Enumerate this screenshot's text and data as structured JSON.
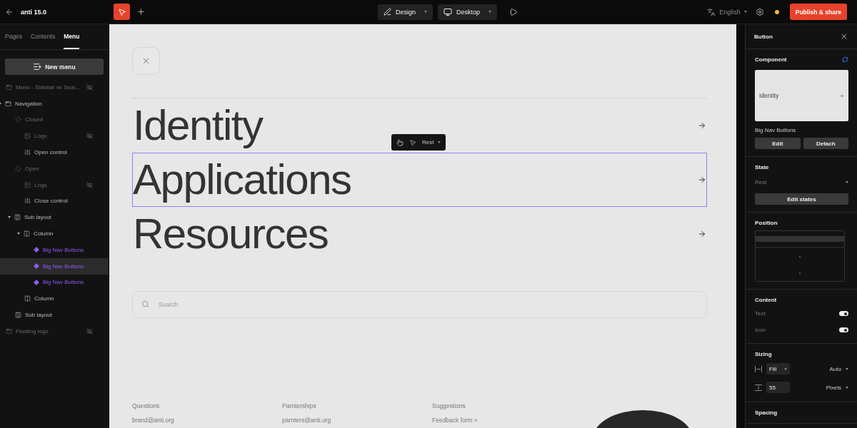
{
  "app": {
    "title": "anti 15.0"
  },
  "toolbar": {
    "mode": "Design",
    "device": "Desktop",
    "language": "English",
    "publish": "Publish & share"
  },
  "sidebar": {
    "tabs": [
      {
        "label": "Pages",
        "selected": false
      },
      {
        "label": "Contents",
        "selected": false
      },
      {
        "label": "Menu",
        "selected": true
      }
    ],
    "new_menu": "New menu",
    "tree": [
      {
        "label": "Menu - Sidebar w/ Sear...",
        "kind": "frame",
        "dimmed": true,
        "hidden": true,
        "selected": false
      },
      {
        "label": "Navigation",
        "kind": "frame",
        "dimmed": false,
        "hidden": false,
        "selected": false,
        "expanded": true,
        "children": [
          {
            "label": "Closed",
            "kind": "state",
            "dimmed": true,
            "hidden": false,
            "selected": false,
            "children": [
              {
                "label": "Logo",
                "kind": "image",
                "dimmed": true,
                "hidden": true,
                "selected": false
              },
              {
                "label": "Open control",
                "kind": "control",
                "dimmed": false,
                "hidden": false,
                "selected": false
              }
            ]
          },
          {
            "label": "Open",
            "kind": "state",
            "dimmed": true,
            "hidden": false,
            "selected": false,
            "children": [
              {
                "label": "Logo",
                "kind": "image",
                "dimmed": true,
                "hidden": true,
                "selected": false
              },
              {
                "label": "Close control",
                "kind": "control",
                "dimmed": false,
                "hidden": false,
                "selected": false
              }
            ]
          },
          {
            "label": "Sub layout",
            "kind": "layout",
            "dimmed": false,
            "hidden": false,
            "selected": false,
            "expanded": true,
            "children": [
              {
                "label": "Column",
                "kind": "column",
                "dimmed": false,
                "hidden": false,
                "selected": false,
                "expanded": true,
                "children": [
                  {
                    "label": "Big Nav Buttons",
                    "kind": "component",
                    "dimmed": false,
                    "hidden": false,
                    "selected": false
                  },
                  {
                    "label": "Big Nav Buttons",
                    "kind": "component",
                    "dimmed": false,
                    "hidden": false,
                    "selected": true
                  },
                  {
                    "label": "Big Nav Buttons",
                    "kind": "component",
                    "dimmed": false,
                    "hidden": false,
                    "selected": false
                  }
                ]
              },
              {
                "label": "Column",
                "kind": "column",
                "dimmed": false,
                "hidden": false,
                "selected": false
              }
            ]
          },
          {
            "label": "Sub layout",
            "kind": "layout",
            "dimmed": false,
            "hidden": false,
            "selected": false
          }
        ]
      },
      {
        "label": "Floating logo",
        "kind": "frame",
        "dimmed": true,
        "hidden": true,
        "selected": false
      }
    ]
  },
  "canvas": {
    "nav_items": [
      {
        "label": "Identity",
        "selected": false
      },
      {
        "label": "Applications",
        "selected": true
      },
      {
        "label": "Resources",
        "selected": false
      }
    ],
    "hover_toolbar": {
      "state": "Rest"
    },
    "search": {
      "placeholder": "Search"
    },
    "footer": [
      {
        "heading": "Questions",
        "link": "brand@anti.org"
      },
      {
        "heading": "Parnterships",
        "link": "parnters@anti.org"
      },
      {
        "heading": "Suggestions",
        "link": "Feedback form »"
      }
    ]
  },
  "inspector": {
    "title": "Button",
    "component": {
      "heading": "Component",
      "preview": "Identity",
      "name": "Big Nav Buttons",
      "buttons": [
        "Edit",
        "Detach"
      ]
    },
    "state": {
      "heading": "State",
      "value": "Rest",
      "button": "Edit states"
    },
    "position": {
      "heading": "Position"
    },
    "content": {
      "heading": "Content",
      "toggles": [
        {
          "label": "Text",
          "on": true
        },
        {
          "label": "Icon",
          "on": true
        }
      ]
    },
    "sizing": {
      "heading": "Sizing",
      "width": {
        "value": "Fill",
        "mode": "Auto"
      },
      "height": {
        "value": "55",
        "mode": "Pixels"
      }
    },
    "spacing": {
      "heading": "Spacing"
    }
  }
}
